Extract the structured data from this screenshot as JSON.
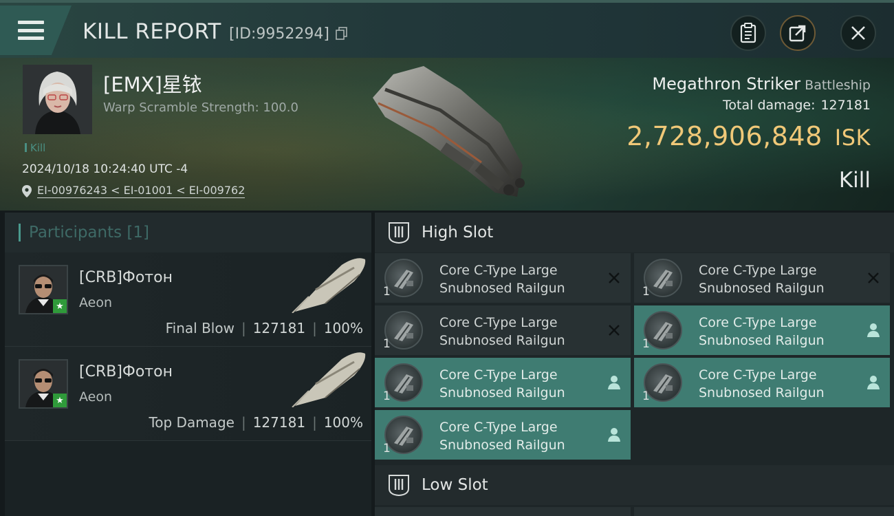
{
  "header": {
    "title": "KILL REPORT",
    "report_id": "[ID:9952294]",
    "menu_icon": "hamburger-menu-icon",
    "actions": [
      {
        "name": "clipboard-icon"
      },
      {
        "name": "share-icon"
      },
      {
        "name": "close-icon"
      }
    ]
  },
  "victim": {
    "name": "[EMX]星铱",
    "warp_scramble": "Warp Scramble Strength: 100.0",
    "kill_tag": "Kill",
    "datetime": "2024/10/18 10:24:40 UTC -4",
    "location": "EI-00976243 < EI-01001 < EI-009762"
  },
  "ship": {
    "name": "Megathron Striker",
    "class": "Battleship",
    "total_damage_label": "Total damage:",
    "total_damage": "127181",
    "isk_value": "2,728,906,848",
    "isk_unit": "ISK",
    "result": "Kill"
  },
  "participants": {
    "label": "Participants",
    "count": "[1]",
    "rows": [
      {
        "name": "[CRB]Фотон",
        "ship": "Aeon",
        "label": "Final Blow",
        "damage": "127181",
        "percent": "100%"
      },
      {
        "name": "[CRB]Фотон",
        "ship": "Aeon",
        "label": "Top Damage",
        "damage": "127181",
        "percent": "100%"
      }
    ]
  },
  "fitting": {
    "high_slot_label": "High Slot",
    "low_slot_label": "Low Slot",
    "high_modules": [
      {
        "line1": "Core C-Type Large",
        "line2": "Snubnosed Railgun",
        "qty": "1",
        "state": "offline"
      },
      {
        "line1": "Core C-Type Large",
        "line2": "Snubnosed Railgun",
        "qty": "1",
        "state": "offline"
      },
      {
        "line1": "Core C-Type Large",
        "line2": "Snubnosed Railgun",
        "qty": "1",
        "state": "offline"
      },
      {
        "line1": "Core C-Type Large",
        "line2": "Snubnosed Railgun",
        "qty": "1",
        "state": "online"
      },
      {
        "line1": "Core C-Type Large",
        "line2": "Snubnosed Railgun",
        "qty": "1",
        "state": "online"
      },
      {
        "line1": "Core C-Type Large",
        "line2": "Snubnosed Railgun",
        "qty": "1",
        "state": "online"
      },
      {
        "line1": "Core C-Type Large",
        "line2": "Snubnosed Railgun",
        "qty": "1",
        "state": "online"
      }
    ]
  },
  "colors": {
    "isk_gold": "#f0c878",
    "online_teal": "#3f7c72",
    "accent_teal": "#4a9a8e",
    "corp_badge_green": "#2f9a3a"
  }
}
